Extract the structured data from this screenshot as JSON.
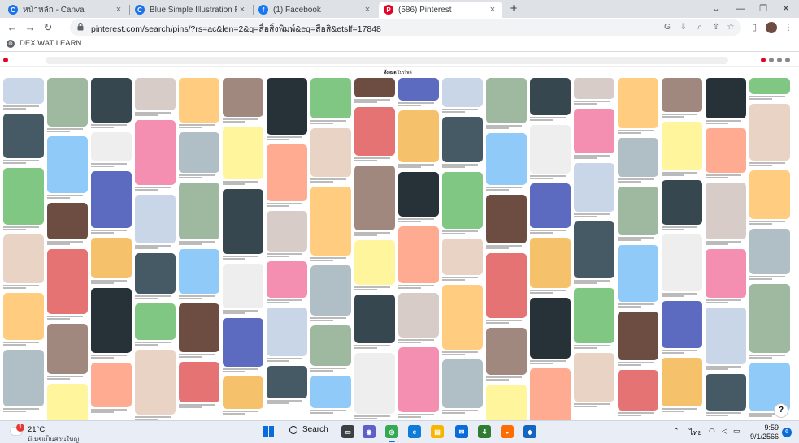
{
  "tabs": [
    {
      "label": "หน้าหลัก - Canva",
      "icon": "canva-icon",
      "color": "#1a73e8",
      "active": false
    },
    {
      "label": "Blue Simple Illustration Romance",
      "icon": "canva-icon",
      "color": "#1a73e8",
      "active": false
    },
    {
      "label": "(1) Facebook",
      "icon": "facebook-icon",
      "color": "#1877f2",
      "active": false
    },
    {
      "label": "(586) Pinterest",
      "icon": "pinterest-icon",
      "color": "#e60023",
      "active": true
    }
  ],
  "address_bar": {
    "url": "pinterest.com/search/pins/?rs=ac&len=2&q=สื่อสิ่งพิมพ์&eq=สื่อสิ&etslf=17848"
  },
  "bookmarks": [
    {
      "label": "DEX WAT LEARN",
      "icon": "globe-icon"
    }
  ],
  "pinterest": {
    "accent": "#e60023",
    "tabs": [
      "ทั้งหมด",
      "โปรไฟล์"
    ]
  },
  "taskbar": {
    "weather_temp": "21°C",
    "weather_desc": "มีเมฆเป็นส่วนใหญ่",
    "weather_badge": "1",
    "search_label": "Search",
    "language": "ไทย",
    "time": "9:59",
    "date": "9/1/2566",
    "notification_count": "6"
  },
  "help_label": "?"
}
